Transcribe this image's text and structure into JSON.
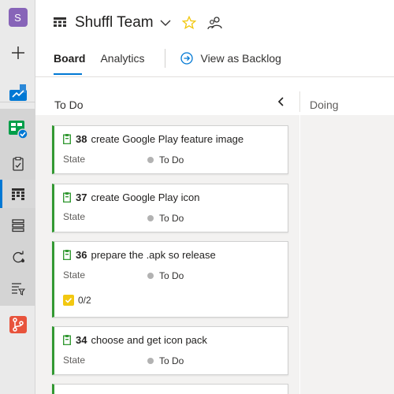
{
  "rail": {
    "project_initial": "S",
    "items": [
      {
        "icon": "project-avatar",
        "name": "project-avatar"
      },
      {
        "icon": "plus-icon",
        "name": "new-item"
      },
      {
        "icon": "overview-icon",
        "name": "overview"
      },
      {
        "icon": "boards-icon",
        "name": "boards"
      },
      {
        "icon": "work-items-icon",
        "name": "work-items"
      },
      {
        "icon": "board-grid-icon",
        "name": "boards-board"
      },
      {
        "icon": "backlogs-icon",
        "name": "backlogs"
      },
      {
        "icon": "sprints-icon",
        "name": "sprints"
      },
      {
        "icon": "queries-icon",
        "name": "queries"
      },
      {
        "icon": "repos-icon",
        "name": "repos"
      }
    ]
  },
  "header": {
    "team_name": "Shuffl Team",
    "tabs": [
      {
        "label": "Board",
        "selected": true
      },
      {
        "label": "Analytics",
        "selected": false
      }
    ],
    "backlog_link": "View as Backlog"
  },
  "board": {
    "columns": [
      {
        "title": "To Do"
      },
      {
        "title": "Doing"
      }
    ],
    "cards": [
      {
        "id": "38",
        "title": "create Google Play feature image",
        "state_label": "State",
        "state": "To Do"
      },
      {
        "id": "37",
        "title": "create Google Play icon",
        "state_label": "State",
        "state": "To Do"
      },
      {
        "id": "36",
        "title": "prepare the .apk so release",
        "state_label": "State",
        "state": "To Do",
        "checklist": "0/2"
      },
      {
        "id": "34",
        "title": "choose and get icon pack",
        "state_label": "State",
        "state": "To Do"
      }
    ]
  },
  "colors": {
    "accent": "#0078d4",
    "card_border": "#339933",
    "project_avatar": "#8764b8",
    "star": "#f2c811",
    "state_dot": "#b2b2b2"
  }
}
